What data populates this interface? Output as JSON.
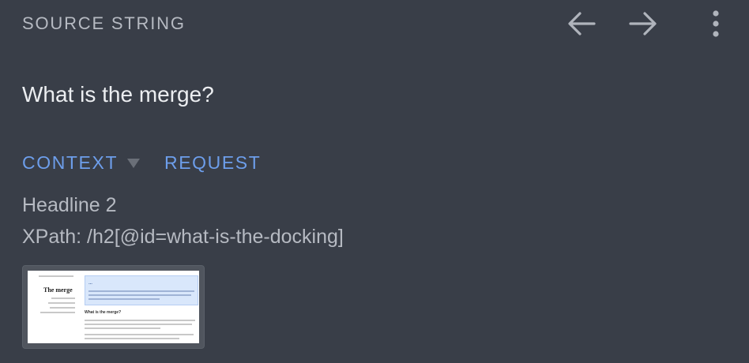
{
  "header": {
    "title": "SOURCE STRING",
    "prev_icon": "arrow-left-icon",
    "next_icon": "arrow-right-icon",
    "more_icon": "more-vertical-icon"
  },
  "source": {
    "text": "What is the merge?"
  },
  "tabs": {
    "context_label": "CONTEXT",
    "request_label": "REQUEST",
    "caret_icon": "caret-down-icon"
  },
  "context": {
    "kind": "Headline 2",
    "xpath": "XPath: /h2[@id=what-is-the-docking]"
  },
  "thumbnail": {
    "page_title": "The merge",
    "hero_title": "…",
    "section_heading": "What is the merge?"
  },
  "colors": {
    "background": "#393e48",
    "label": "#b6bac2",
    "text": "#eceef1",
    "accent": "#6d9eeb",
    "icon": "#b0b4bc"
  }
}
